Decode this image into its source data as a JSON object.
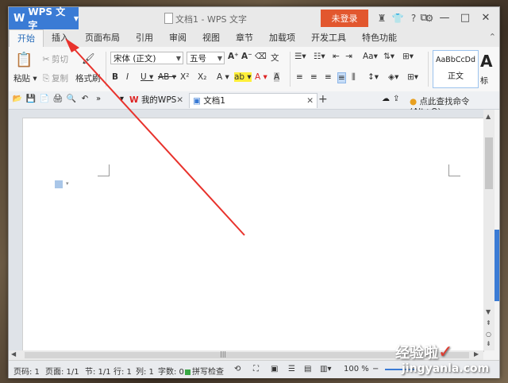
{
  "titlebar": {
    "app_name": "WPS 文字",
    "title": "文档1 - WPS 文字",
    "login": "未登录"
  },
  "menu_tabs": [
    "开始",
    "插入",
    "页面布局",
    "引用",
    "审阅",
    "视图",
    "章节",
    "加载项",
    "开发工具",
    "特色功能"
  ],
  "ribbon": {
    "cut": "剪切",
    "paste": "粘贴",
    "copy": "复制",
    "format_painter": "格式刷",
    "font_name": "宋体 (正文)",
    "font_size": "五号",
    "style_sample": "AaBbCcDd",
    "style_name": "正文",
    "style_big": "A",
    "style_big_label": "标"
  },
  "quickbar": {
    "mywps": "我的WPS",
    "doc_tab": "文档1",
    "help": "点此查找命令 (Alt+Q)"
  },
  "status": {
    "page_num": "页码: 1",
    "pages": "页面: 1/1",
    "section": "节: 1/1",
    "row": "行: 1",
    "col": "列: 1",
    "words": "字数: 0",
    "spell": "拼写检查",
    "zoom": "100 %"
  },
  "watermark": {
    "line1": "经验啦",
    "line2": "jingyanla.com",
    "bai": "Bai"
  },
  "accent_colors": {
    "app": "#3a7bd5",
    "login": "#e2572e",
    "arrow": "#e8322c"
  }
}
